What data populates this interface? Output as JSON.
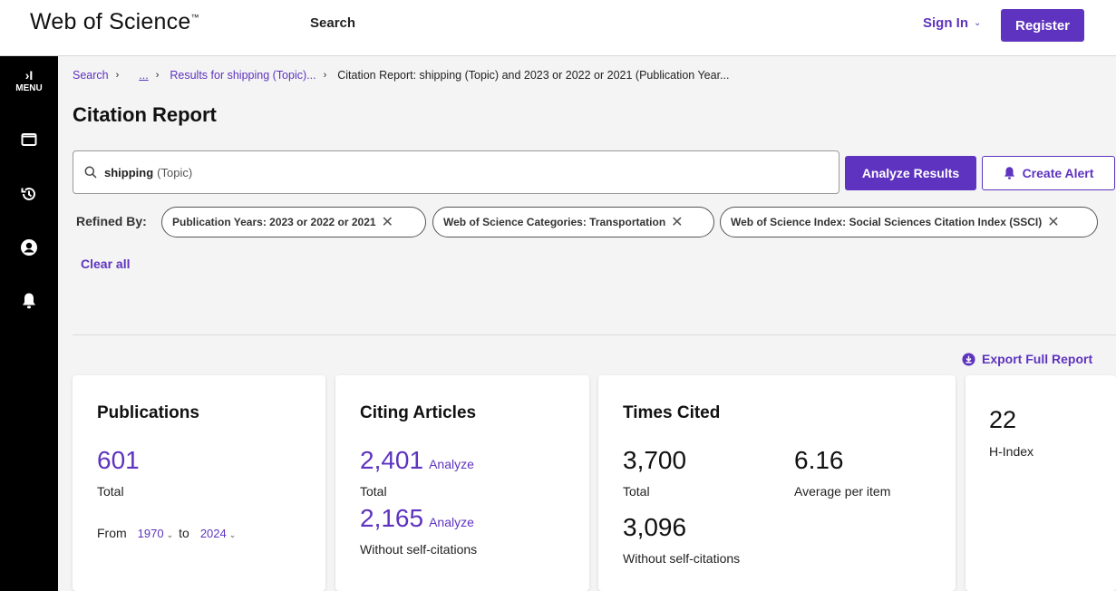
{
  "header": {
    "brand": "Web of Science",
    "brand_tm": "™",
    "search_link": "Search",
    "sign_in": "Sign In",
    "register": "Register"
  },
  "rail": {
    "menu_label": "MENU",
    "menu_arrows": "›I"
  },
  "breadcrumb": {
    "search": "Search",
    "ellipsis": "...",
    "results": "Results for shipping (Topic)...",
    "current": "Citation Report: shipping (Topic) and 2023 or 2022 or 2021 (Publication Year..."
  },
  "page_title": "Citation Report",
  "query": {
    "term": "shipping",
    "field": "(Topic)"
  },
  "buttons": {
    "analyze_results": "Analyze Results",
    "create_alert": "Create Alert",
    "export_full_report": "Export Full Report",
    "clear_all": "Clear all"
  },
  "refined": {
    "label": "Refined By:",
    "chips": [
      "Publication Years: 2023 or 2022 or 2021",
      "Web of Science Categories: Transportation",
      "Web of Science Index: Social Sciences Citation Index (SSCI)"
    ],
    "remove_glyph": "✕"
  },
  "cards": {
    "publications": {
      "title": "Publications",
      "total": "601",
      "total_label": "Total",
      "from_label": "From",
      "from_year": "1970",
      "to_label": "to",
      "to_year": "2024"
    },
    "citing": {
      "title": "Citing Articles",
      "total": "2,401",
      "total_analyze": "Analyze",
      "total_label": "Total",
      "without_self": "2,165",
      "without_analyze": "Analyze",
      "without_label": "Without self-citations"
    },
    "times_cited": {
      "title": "Times Cited",
      "total": "3,700",
      "total_label": "Total",
      "average": "6.16",
      "average_label": "Average per item",
      "without_self": "3,096",
      "without_label": "Without self-citations"
    },
    "h_index": {
      "value": "22",
      "label": "H-Index"
    }
  },
  "colors": {
    "accent": "#5e33bf",
    "rail": "#000000",
    "background": "#f4f4f4"
  }
}
